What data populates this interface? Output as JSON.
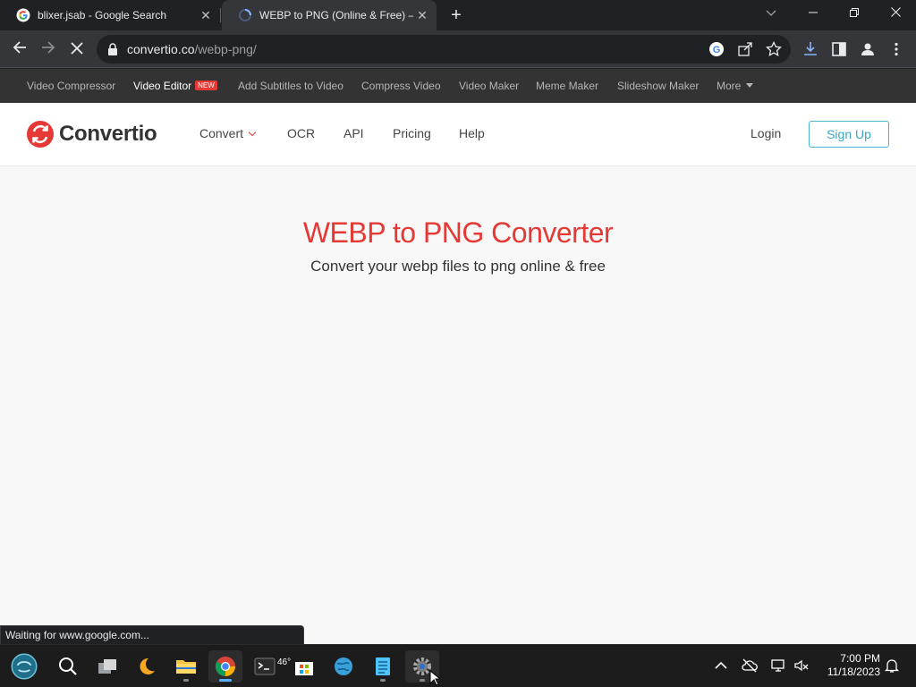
{
  "browser": {
    "tabs": [
      {
        "title": "blixer.jsab - Google Search",
        "favicon": "google-icon",
        "active": false
      },
      {
        "title": "WEBP to PNG (Online & Free) —",
        "favicon": "loading-spinner-icon",
        "active": true
      }
    ],
    "url_host": "convertio.co",
    "url_path": "/webp-png/",
    "status_text": "Waiting for www.google.com..."
  },
  "topbar": {
    "links": [
      {
        "label": "Video Compressor"
      },
      {
        "label": "Video Editor",
        "badge": "NEW"
      },
      {
        "label": "Add Subtitles to Video"
      },
      {
        "label": "Compress Video"
      },
      {
        "label": "Video Maker"
      },
      {
        "label": "Meme Maker"
      },
      {
        "label": "Slideshow Maker"
      },
      {
        "label": "More"
      }
    ]
  },
  "header": {
    "logo_text": "Convertio",
    "nav": [
      {
        "label": "Convert"
      },
      {
        "label": "OCR"
      },
      {
        "label": "API"
      },
      {
        "label": "Pricing"
      },
      {
        "label": "Help"
      }
    ],
    "login_label": "Login",
    "signup_label": "Sign Up"
  },
  "hero": {
    "title": "WEBP to PNG Converter",
    "subtitle": "Convert your webp files to png online & free"
  },
  "taskbar": {
    "weather_temp": "46°",
    "clock_time": "7:00 PM",
    "clock_date": "11/18/2023"
  },
  "colors": {
    "brand_red": "#e53935",
    "signup_accent": "#3aa7c0",
    "browser_dark": "#202124"
  }
}
